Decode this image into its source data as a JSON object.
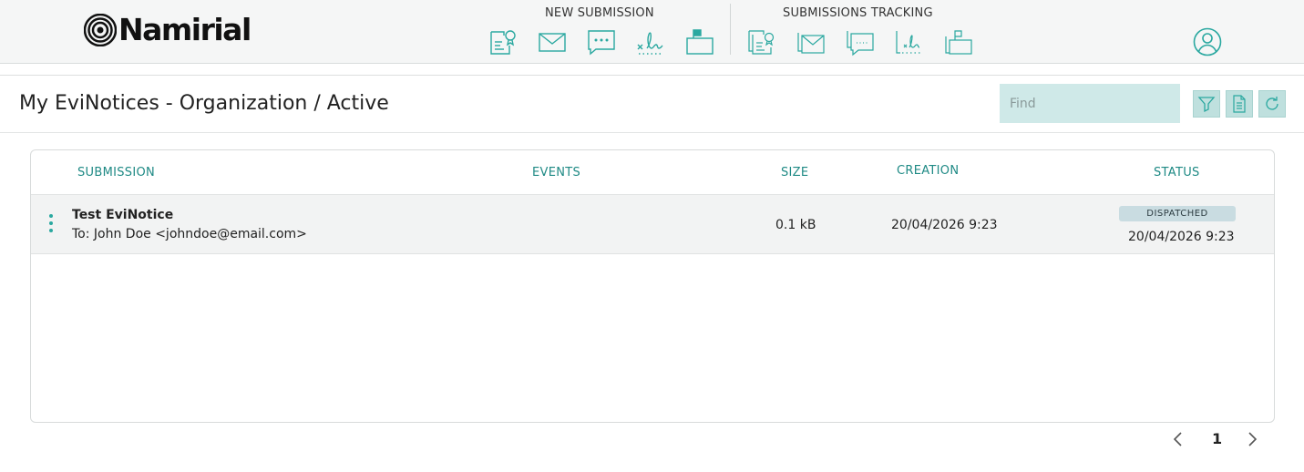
{
  "brand": {
    "name": "Namirial"
  },
  "nav": {
    "new_submission_label": "NEW SUBMISSION",
    "tracking_label": "SUBMISSIONS TRACKING",
    "new_icons": [
      "certified-document-icon",
      "mail-icon",
      "sms-icon",
      "signature-icon",
      "mailbox-icon"
    ],
    "tracking_icons": [
      "documents-tracking-icon",
      "mail-tracking-icon",
      "sms-tracking-icon",
      "signature-tracking-icon",
      "mailbox-tracking-icon"
    ],
    "user_icon": "user-icon"
  },
  "colors": {
    "accent": "#2aa8a0",
    "header_text": "#1f8a85",
    "find_bg": "#cfe9e8",
    "badge_bg": "#c9dce1"
  },
  "page": {
    "title": "My EviNotices - Organization / Active"
  },
  "search": {
    "placeholder": "Find",
    "value": ""
  },
  "toolbar": {
    "icons": [
      "filter-icon",
      "export-document-icon",
      "refresh-icon"
    ]
  },
  "table": {
    "columns": [
      "SUBMISSION",
      "EVENTS",
      "SIZE",
      "CREATION",
      "STATUS"
    ],
    "rows": [
      {
        "subject": "Test EviNotice",
        "recipient": "To: John Doe <johndoe@email.com>",
        "events": "",
        "size": "0.1 kB",
        "creation": "20/04/2026 9:23",
        "status": "DISPATCHED",
        "status_date": "20/04/2026 9:23"
      }
    ]
  },
  "pagination": {
    "current": "1"
  }
}
